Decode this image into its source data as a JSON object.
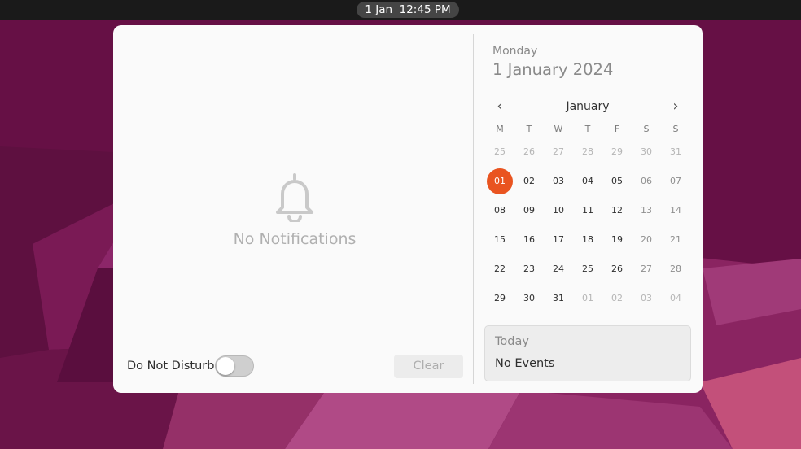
{
  "topbar": {
    "clock": "1 Jan  12:45 PM"
  },
  "notifications": {
    "empty_text": "No Notifications",
    "dnd_label": "Do Not Disturb",
    "dnd_on": false,
    "clear_label": "Clear",
    "bell_icon": "bell-icon"
  },
  "calendar": {
    "weekday": "Monday",
    "full_date": "1 January 2024",
    "month": "January",
    "prev_icon": "‹",
    "next_icon": "›",
    "weekdays": [
      "M",
      "T",
      "W",
      "T",
      "F",
      "S",
      "S"
    ],
    "weeks": [
      [
        "25",
        "26",
        "27",
        "28",
        "29",
        "30",
        "31"
      ],
      [
        "01",
        "02",
        "03",
        "04",
        "05",
        "06",
        "07"
      ],
      [
        "08",
        "09",
        "10",
        "11",
        "12",
        "13",
        "14"
      ],
      [
        "15",
        "16",
        "17",
        "18",
        "19",
        "20",
        "21"
      ],
      [
        "22",
        "23",
        "24",
        "25",
        "26",
        "27",
        "28"
      ],
      [
        "29",
        "30",
        "31",
        "01",
        "02",
        "03",
        "04"
      ]
    ],
    "selected_day": "01",
    "today_accent": "#e95420"
  },
  "events": {
    "title": "Today",
    "empty_text": "No Events"
  },
  "colors": {
    "accent": "#e95420",
    "panel_bg": "#fafafa",
    "topbar_bg": "#1a1a1a"
  }
}
